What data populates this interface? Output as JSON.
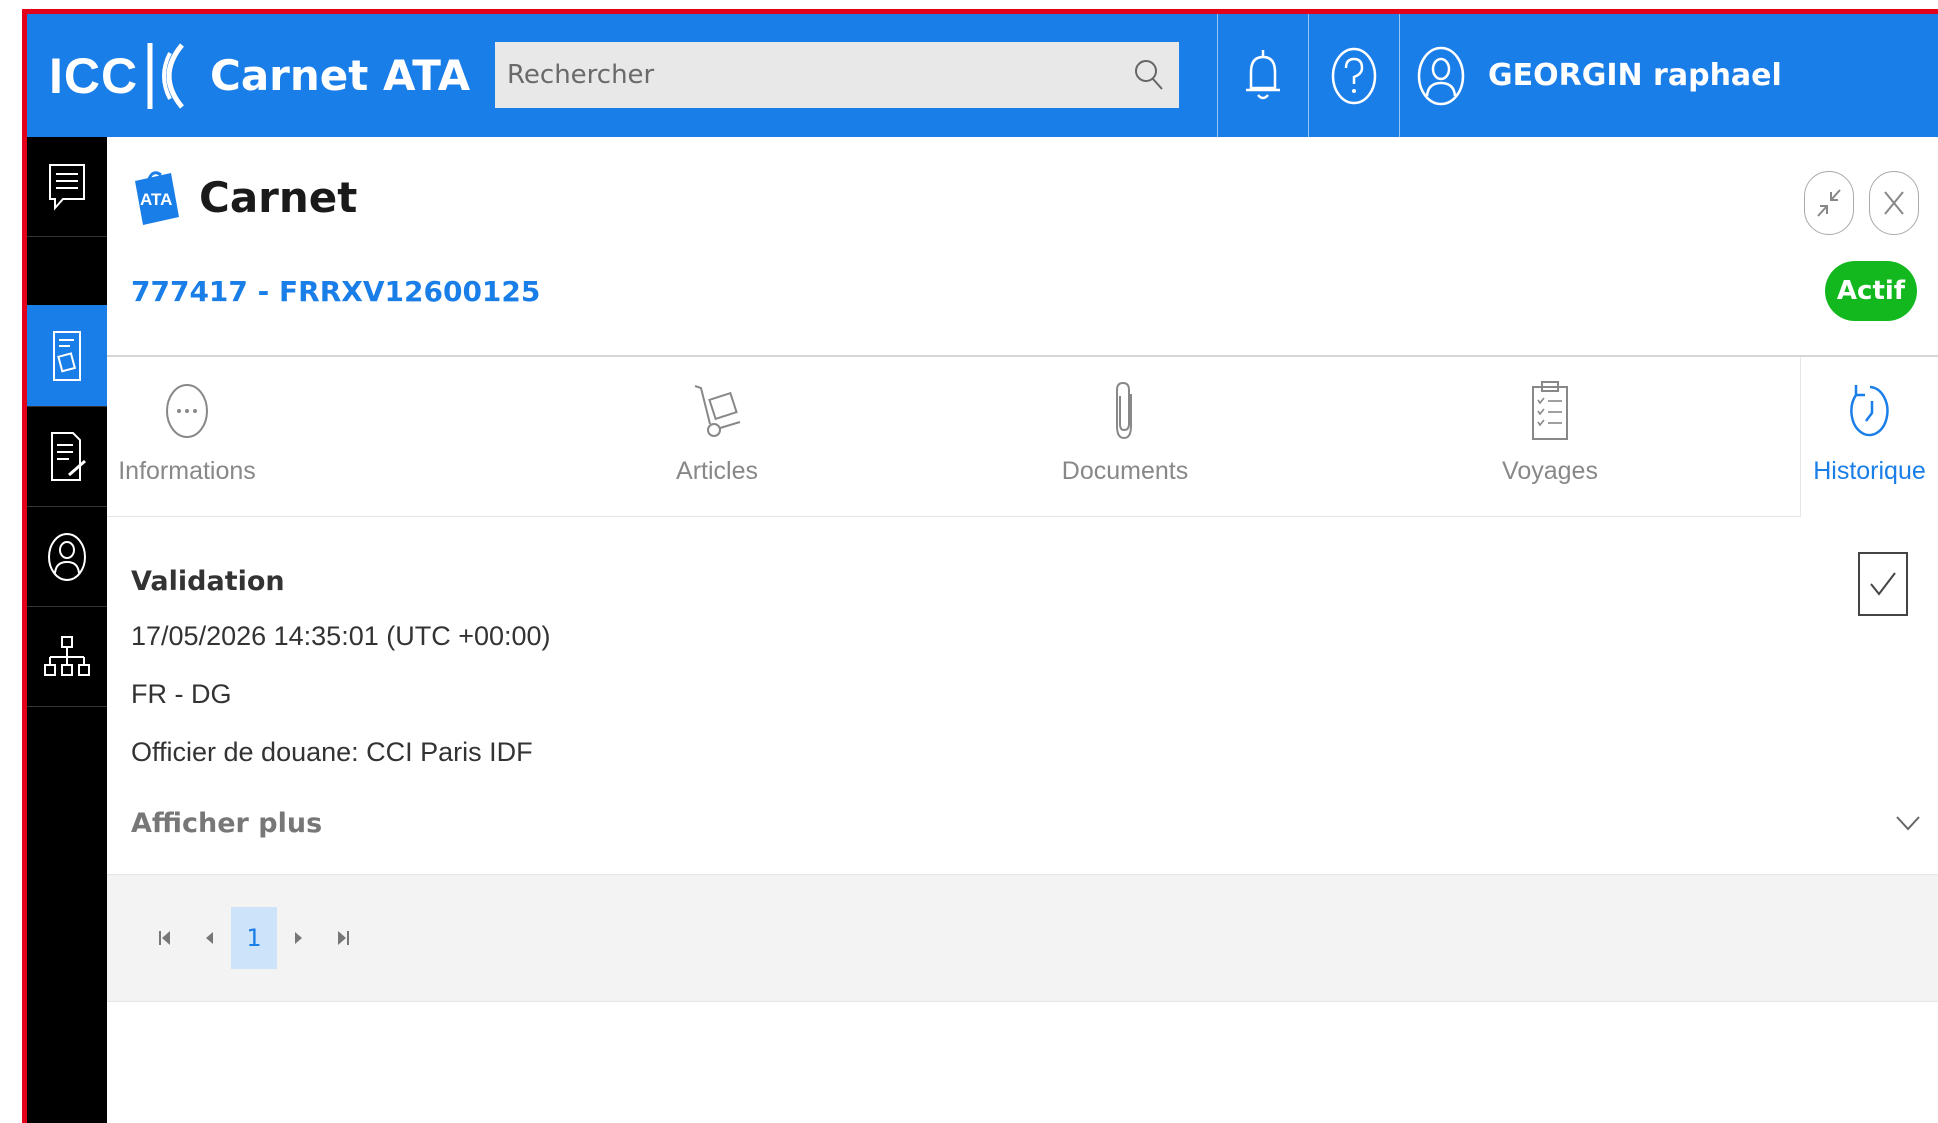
{
  "header": {
    "logo_text": "ICC",
    "app_title": "Carnet ATA",
    "search_placeholder": "Rechercher",
    "user_name": "GEORGIN raphael",
    "accent_color": "#1a7ee8"
  },
  "sidebar": {
    "items": [
      {
        "icon": "messages-icon",
        "active": false
      },
      {
        "icon": "carnet-icon",
        "active": true
      },
      {
        "icon": "document-edit-icon",
        "active": false
      },
      {
        "icon": "user-icon",
        "active": false
      },
      {
        "icon": "organization-icon",
        "active": false
      }
    ]
  },
  "main": {
    "badge_text": "ATA",
    "title": "Carnet",
    "carnet_id": "777417 - FRRXV12600125",
    "status": "Actif",
    "status_color": "#13b81f"
  },
  "tabs": [
    {
      "label": "Informations",
      "icon": "more-icon",
      "active": false
    },
    {
      "label": "Articles",
      "icon": "hand-truck-icon",
      "active": false
    },
    {
      "label": "Documents",
      "icon": "paperclip-icon",
      "active": false
    },
    {
      "label": "Voyages",
      "icon": "clipboard-icon",
      "active": false
    },
    {
      "label": "Historique",
      "icon": "history-icon",
      "active": true
    }
  ],
  "history_entry": {
    "title": "Validation",
    "datetime": "17/05/2026 14:35:01 (UTC +00:00)",
    "location": "FR - DG",
    "officer": "Officier de douane: CCI Paris IDF",
    "show_more": "Afficher plus"
  },
  "pagination": {
    "current_page": "1"
  }
}
